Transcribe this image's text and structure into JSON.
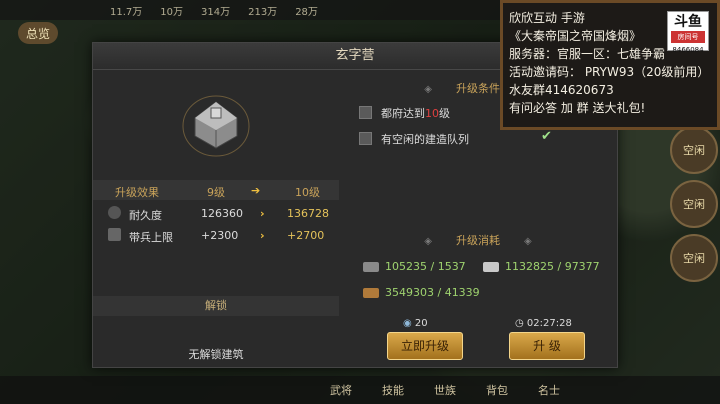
{
  "topbar": {
    "items": [
      "11.7万",
      "10万",
      "314万",
      "213万",
      "28万"
    ]
  },
  "nav": {
    "overview_label": "总览"
  },
  "right_column": {
    "items": [
      "空闲",
      "空闲",
      "空闲"
    ]
  },
  "bottombar": {
    "items": [
      "武将",
      "技能",
      "世族",
      "背包",
      "名士"
    ]
  },
  "overlay": {
    "lines": [
      "欣欣互动  手游",
      "《大秦帝国之帝国烽烟》",
      "服务器：官服一区：七雄争霸",
      "活动邀请码： PRYW93（20级前用）",
      "水友群414620673",
      "有问必答 加 群 送大礼包!"
    ],
    "logo_title": "斗鱼",
    "logo_sub": "房间号",
    "logo_id": "8466084"
  },
  "dialog": {
    "title": "玄字营",
    "effects": {
      "header": "升级效果",
      "cur_level": "9级",
      "next_level": "10级",
      "rows": [
        {
          "label": "耐久度",
          "cur": "126360",
          "next": "136728"
        },
        {
          "label": "带兵上限",
          "cur": "+2300",
          "next": "+2700"
        }
      ]
    },
    "unlock": {
      "header": "解锁",
      "text": "无解锁建筑"
    },
    "conditions": {
      "header": "升级条件",
      "items": [
        {
          "prefix": "都府达到",
          "highlight": "10",
          "suffix": "级"
        },
        {
          "text": "有空闲的建造队列"
        }
      ]
    },
    "costs": {
      "header": "升级消耗",
      "items": [
        {
          "icon": "stone-icon",
          "value": "105235 / 1537"
        },
        {
          "icon": "iron-icon",
          "value": "1132825 / 97377"
        },
        {
          "icon": "wood-icon",
          "value": "3549303 / 41339"
        }
      ]
    },
    "gold_cost": "20",
    "duration": "02:27:28",
    "buttons": {
      "instant": "立即升级",
      "upgrade": "升 级"
    }
  },
  "colors": {
    "accent": "#c9a35a",
    "highlight_red": "#e04040",
    "resource_green": "#9fd36f"
  }
}
